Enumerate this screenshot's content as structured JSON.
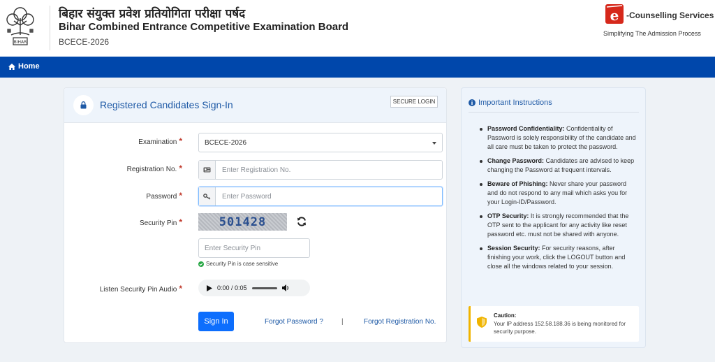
{
  "header": {
    "hindi_title": "बिहार संयुक्त प्रवेश प्रतियोगिता परीक्षा पर्षद",
    "board_title": "Bihar Combined Entrance Competitive Examination Board",
    "board_sub": "BCECE-2026",
    "emblem_text": "BIHAR",
    "ec_title": "-Counselling Services",
    "ec_tagline": "Simplifying The Admission Process",
    "ec_logo_letter": "e"
  },
  "nav": {
    "home": "Home"
  },
  "login": {
    "title": "Registered Candidates Sign-In",
    "secure_badge": "SECURE LOGIN",
    "exam_label": "Examination",
    "exam_value": "BCECE-2026",
    "reg_label": "Registration No.",
    "reg_placeholder": "Enter Registration No.",
    "pwd_label": "Password",
    "pwd_placeholder": "Enter Password",
    "pin_label": "Security Pin",
    "captcha_text": "501428",
    "pin_placeholder": "Enter Security Pin",
    "pin_hint": "Security Pin is case sensitive",
    "audio_label": "Listen Security Pin Audio",
    "audio_time": "0:00 / 0:05",
    "signin": "Sign In",
    "forgot_password": "Forgot Password ?",
    "separator": "|",
    "forgot_reg": "Forgot Registration No.",
    "required_mark": "*"
  },
  "instructions": {
    "title": "Important Instructions",
    "items": [
      {
        "title": "Password Confidentiality:",
        "text": " Confidentiality of Password is solely responsibility of the candidate and all care must be taken to protect the password."
      },
      {
        "title": "Change Password:",
        "text": " Candidates are advised to keep changing the Password at frequent intervals."
      },
      {
        "title": "Beware of Phishing:",
        "text": " Never share your password and do not respond to any mail which asks you for your Login-ID/Password."
      },
      {
        "title": "OTP Security:",
        "text": " It is strongly recommended that the OTP sent to the applicant for any activity like reset password etc. must not be shared with anyone."
      },
      {
        "title": "Session Security:",
        "text": " For security reasons, after finishing your work, click the LOGOUT button and close all the windows related to your session."
      }
    ],
    "caution_title": "Caution:",
    "caution_text": "Your IP address 152.58.188.36 is being monitored for security purpose."
  },
  "colors": {
    "nav": "#0047ab",
    "primary_button": "#0d6efd",
    "link": "#1f5aa6",
    "caution_border": "#f0b400",
    "brand_red": "#d6281b"
  }
}
